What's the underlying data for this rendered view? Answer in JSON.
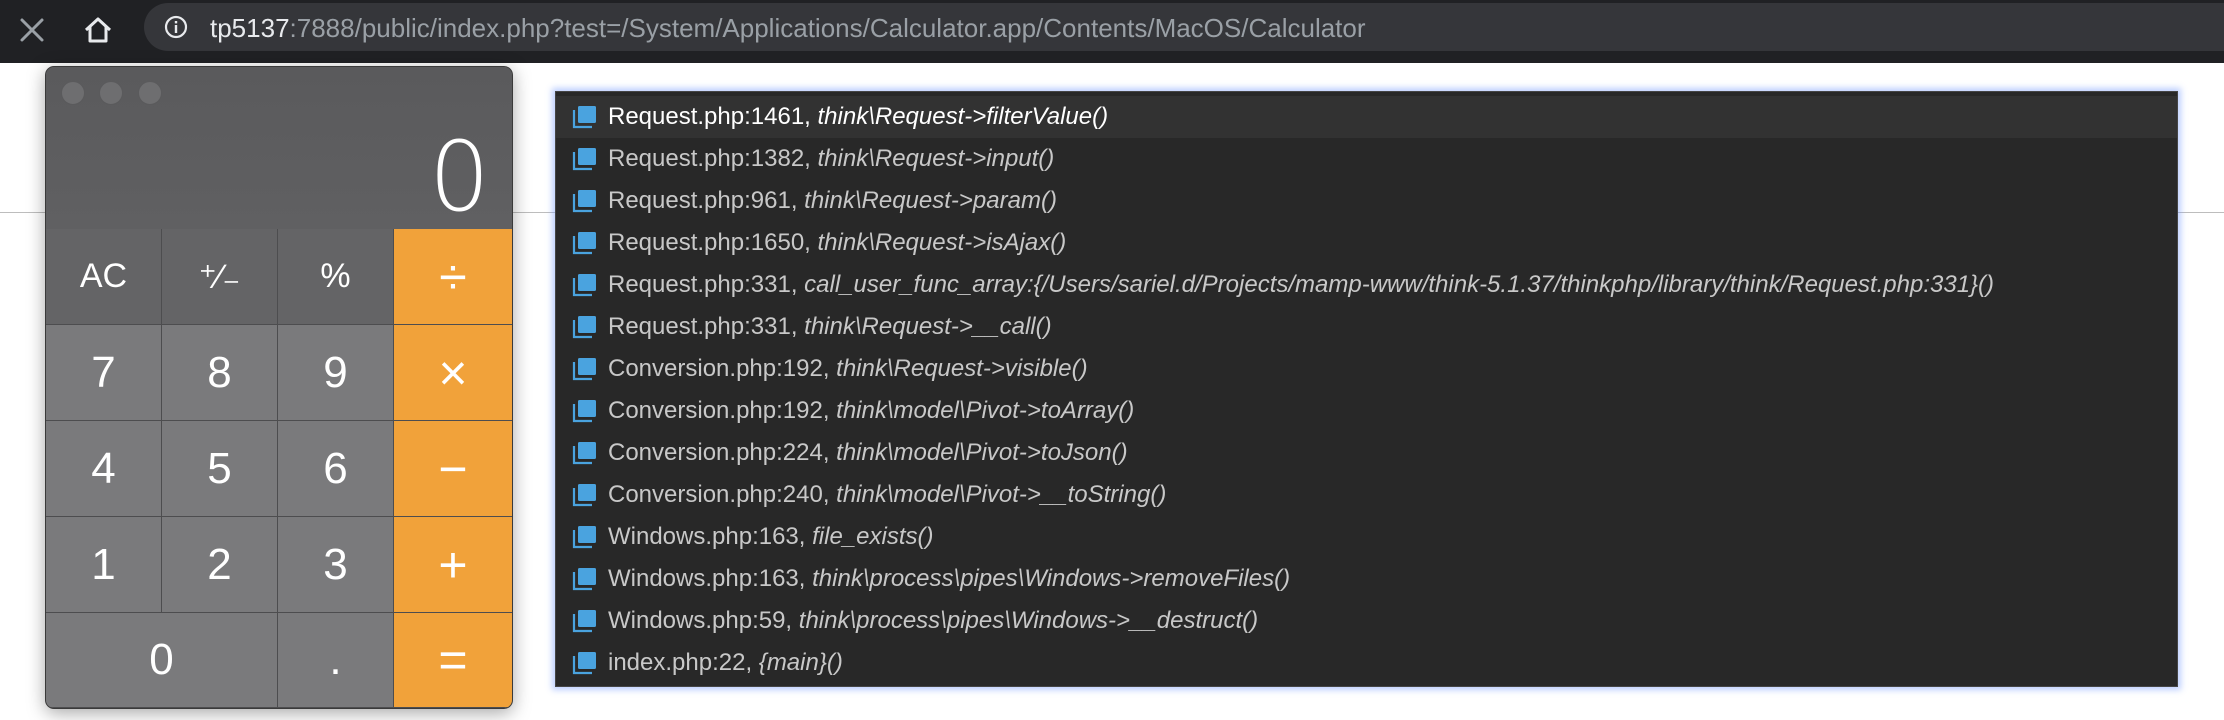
{
  "browser": {
    "url_host": "tp5137",
    "url_rest": ":7888/public/index.php?test=/System/Applications/Calculator.app/Contents/MacOS/Calculator",
    "icons": {
      "close": "close-icon",
      "home": "home-icon",
      "info": "info-icon"
    }
  },
  "calculator": {
    "display": "0",
    "keys": [
      {
        "label": "AC",
        "kind": "fn"
      },
      {
        "label": "⁺∕₋",
        "kind": "fn"
      },
      {
        "label": "%",
        "kind": "fn"
      },
      {
        "label": "÷",
        "kind": "op"
      },
      {
        "label": "7",
        "kind": "num"
      },
      {
        "label": "8",
        "kind": "num"
      },
      {
        "label": "9",
        "kind": "num"
      },
      {
        "label": "×",
        "kind": "op"
      },
      {
        "label": "4",
        "kind": "num"
      },
      {
        "label": "5",
        "kind": "num"
      },
      {
        "label": "6",
        "kind": "num"
      },
      {
        "label": "−",
        "kind": "op"
      },
      {
        "label": "1",
        "kind": "num"
      },
      {
        "label": "2",
        "kind": "num"
      },
      {
        "label": "3",
        "kind": "num"
      },
      {
        "label": "+",
        "kind": "op"
      },
      {
        "label": "0",
        "kind": "num zero"
      },
      {
        "label": ".",
        "kind": "num"
      },
      {
        "label": "=",
        "kind": "op"
      }
    ],
    "colors": {
      "operator": "#f1a23a",
      "number": "#7a7a7c",
      "function": "#646466"
    }
  },
  "trace": {
    "accent": "#4aa3df",
    "frames": [
      {
        "loc": "Request.php:1461, ",
        "fn": "think\\Request->filterValue()"
      },
      {
        "loc": "Request.php:1382, ",
        "fn": "think\\Request->input()"
      },
      {
        "loc": "Request.php:961, ",
        "fn": "think\\Request->param()"
      },
      {
        "loc": "Request.php:1650, ",
        "fn": "think\\Request->isAjax()"
      },
      {
        "loc": "Request.php:331, ",
        "fn": "call_user_func_array:{/Users/sariel.d/Projects/mamp-www/think-5.1.37/thinkphp/library/think/Request.php:331}()"
      },
      {
        "loc": "Request.php:331, ",
        "fn": "think\\Request->__call()"
      },
      {
        "loc": "Conversion.php:192, ",
        "fn": "think\\Request->visible()"
      },
      {
        "loc": "Conversion.php:192, ",
        "fn": "think\\model\\Pivot->toArray()"
      },
      {
        "loc": "Conversion.php:224, ",
        "fn": "think\\model\\Pivot->toJson()"
      },
      {
        "loc": "Conversion.php:240, ",
        "fn": "think\\model\\Pivot->__toString()"
      },
      {
        "loc": "Windows.php:163, ",
        "fn": "file_exists()"
      },
      {
        "loc": "Windows.php:163, ",
        "fn": "think\\process\\pipes\\Windows->removeFiles()"
      },
      {
        "loc": "Windows.php:59, ",
        "fn": "think\\process\\pipes\\Windows->__destruct()"
      },
      {
        "loc": "index.php:22, ",
        "fn": "{main}()"
      }
    ]
  }
}
